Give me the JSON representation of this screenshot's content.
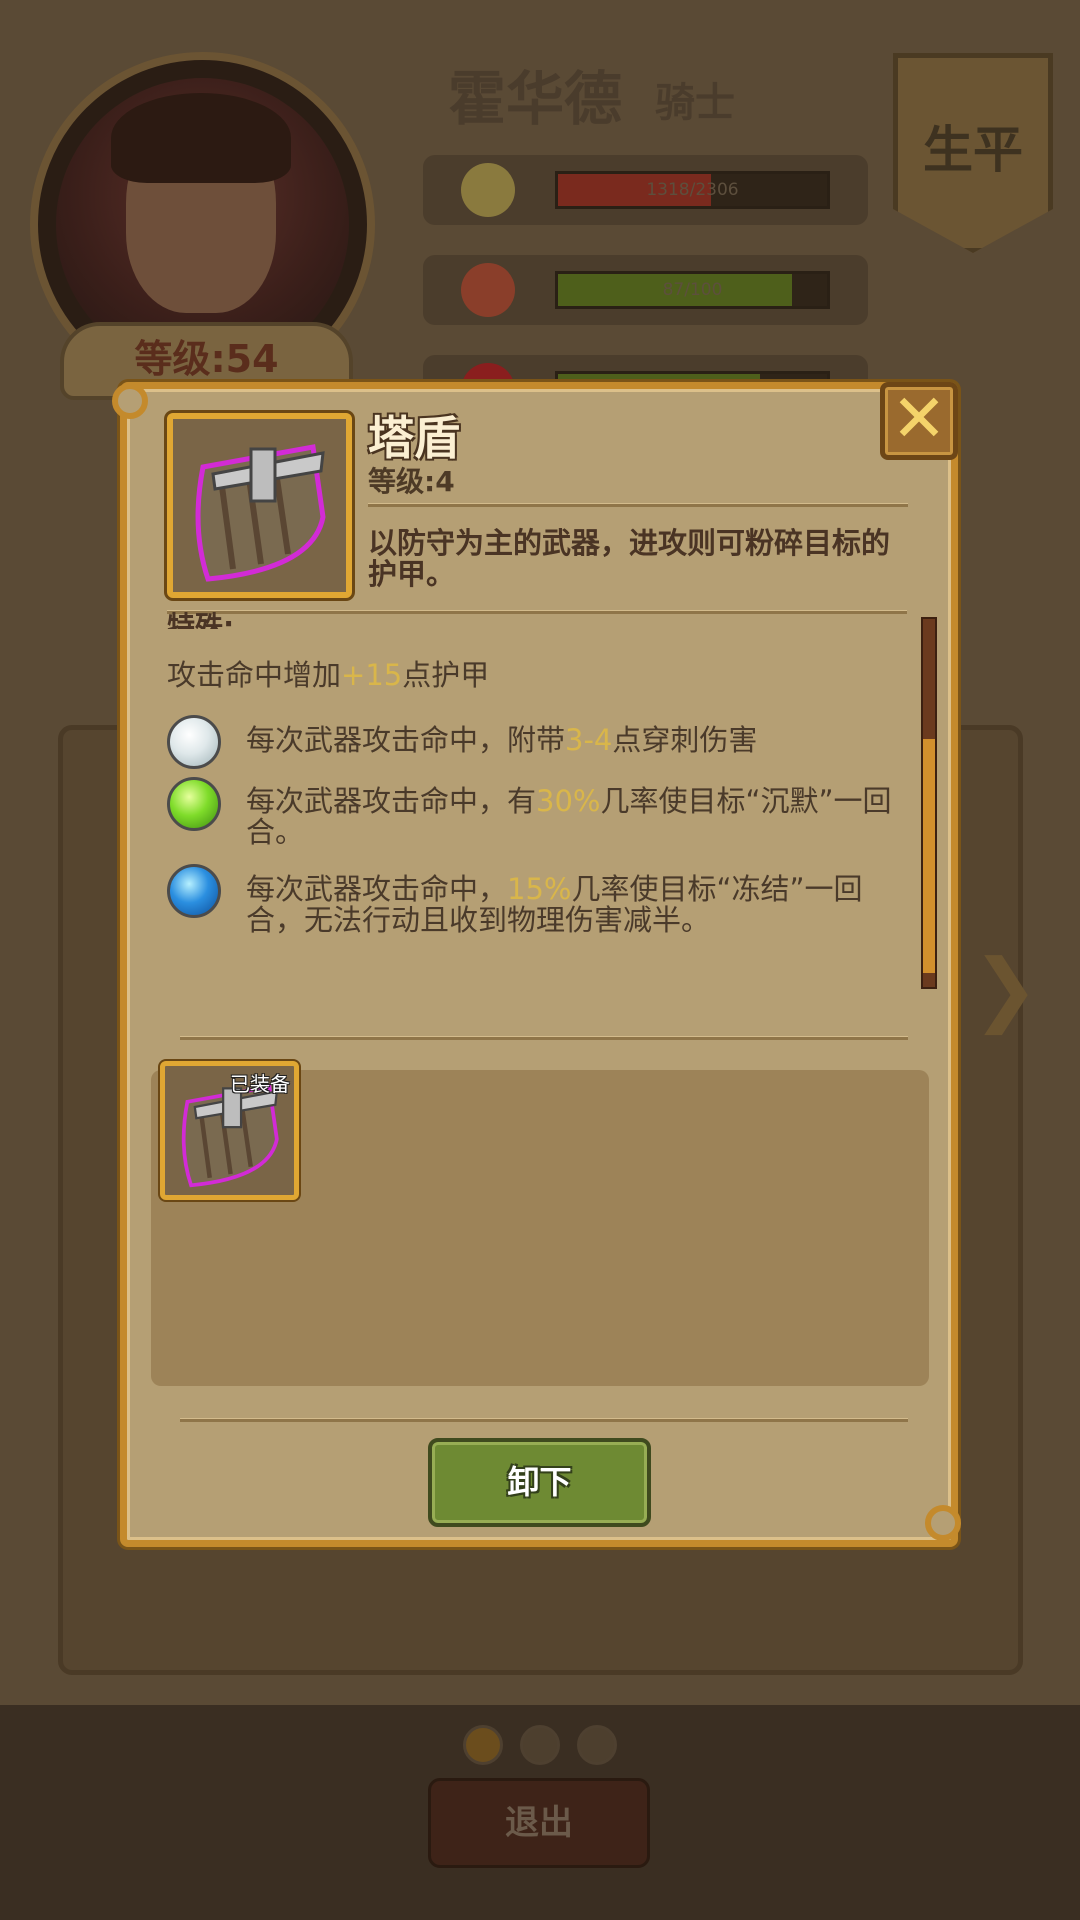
{
  "hero": {
    "name": "霍华德",
    "class": "骑士",
    "level_label": "等级:54",
    "banner_label": "生平",
    "stats": [
      {
        "icon": "medal-icon",
        "value": "1318/2306",
        "fill": 0.57,
        "color": "#7a2a1e"
      },
      {
        "icon": "stomach-icon",
        "value": "87/100",
        "fill": 0.87,
        "color": "#4e5f1b"
      },
      {
        "icon": "heart-icon",
        "value": "",
        "fill": 0.75,
        "color": "#4e5f1b"
      }
    ]
  },
  "item": {
    "name": "塔盾",
    "level_label": "等级:4",
    "description": "以防守为主的武器，进攻则可粉碎目标的护甲。",
    "special_label": "特殊:",
    "base_effect": {
      "pre": "攻击命中增加",
      "hl": "+15",
      "post": "点护甲"
    },
    "gem_effects": [
      {
        "gem": "white-gem-icon",
        "color": "#dfe8ea",
        "pre": "每次武器攻击命中，附带",
        "hl": "3-4",
        "post": "点穿刺伤害"
      },
      {
        "gem": "green-gem-icon",
        "color": "#7fdc2a",
        "pre": "每次武器攻击命中，有",
        "hl": "30%",
        "post": "几率使目标“沉默”一回合。"
      },
      {
        "gem": "blue-gem-icon",
        "color": "#2b8fe0",
        "pre": "每次武器攻击命中，",
        "hl": "15%",
        "post": "几率使目标“冻结”一回合，无法行动且收到物理伤害减半。"
      }
    ]
  },
  "equipped": {
    "tag": "已装备"
  },
  "buttons": {
    "close": "✕",
    "unequip": "卸下",
    "exit": "退出"
  },
  "page_dots": 3,
  "colors": {
    "highlight": "#d9b64a",
    "frame": "#c48a2c",
    "button_green": "#6e8a33"
  }
}
